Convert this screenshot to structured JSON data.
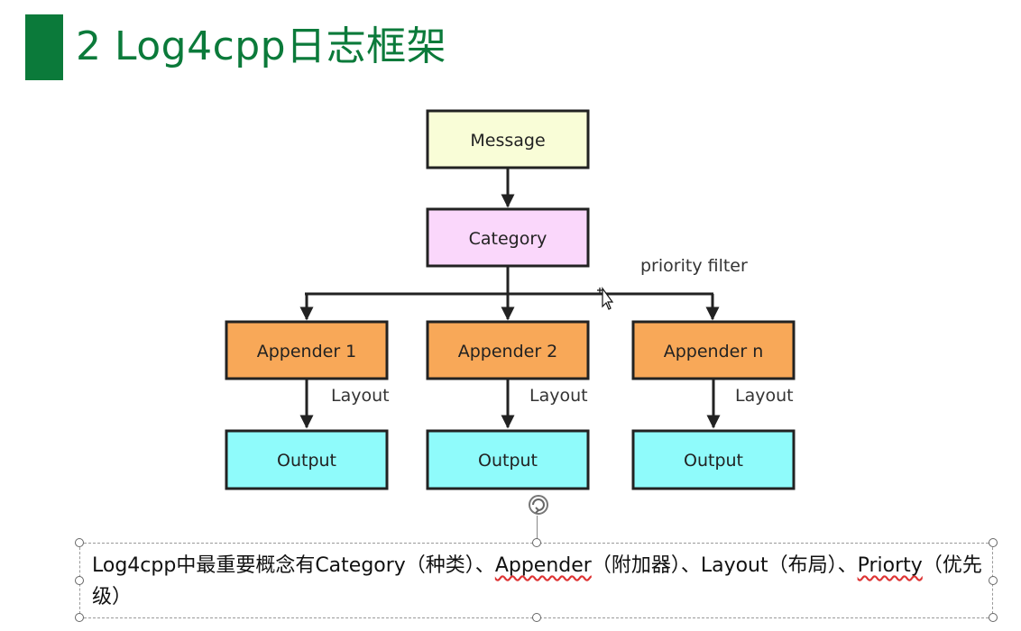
{
  "slide": {
    "title": "2  Log4cpp日志框架"
  },
  "diagram": {
    "nodes": {
      "message": "Message",
      "category": "Category",
      "appender1": "Appender 1",
      "appender2": "Appender 2",
      "appendern": "Appender n",
      "output1": "Output",
      "output2": "Output",
      "output3": "Output"
    },
    "labels": {
      "priority_filter": "priority filter",
      "layout1": "Layout",
      "layout2": "Layout",
      "layout3": "Layout"
    },
    "colors": {
      "message": "#f9fdd7",
      "category": "#fad7fb",
      "appender": "#f8a858",
      "output": "#8ffbfb",
      "title": "#0b7a3a"
    }
  },
  "caption": {
    "part1": "Log4cpp中最重要概念有Category（种类）、",
    "appender": "Appender",
    "part2": "（附加器）、Layout（布局）、",
    "priorty": "Priorty",
    "part3": "（优先级）"
  }
}
